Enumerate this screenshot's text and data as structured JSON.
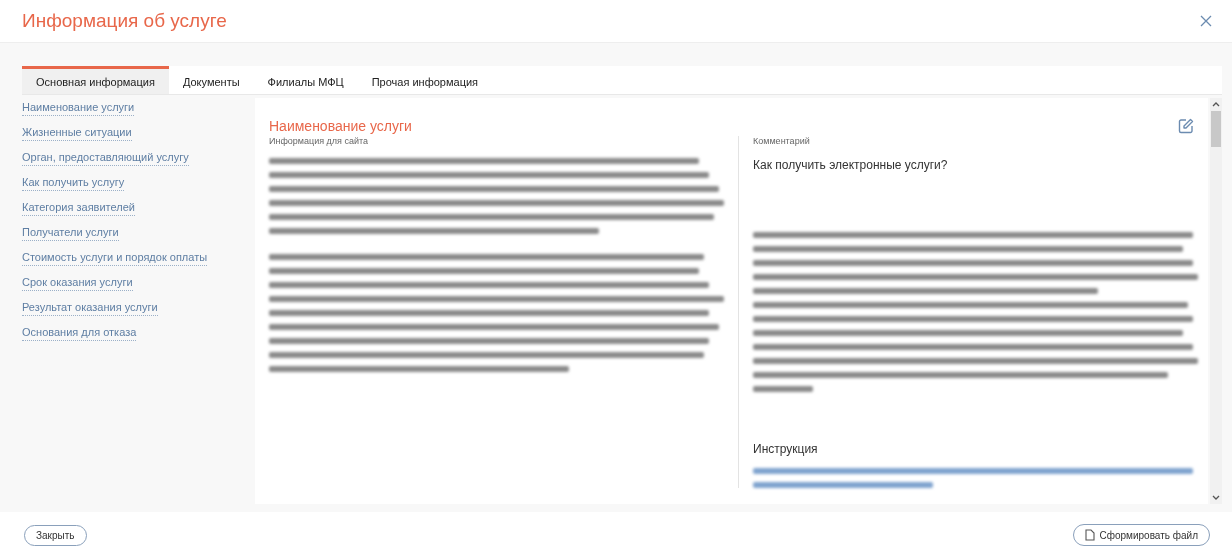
{
  "window": {
    "title": "Информация об услуге"
  },
  "tabs": [
    {
      "label": "Основная информация",
      "selected": true
    },
    {
      "label": "Документы",
      "selected": false
    },
    {
      "label": "Филиалы МФЦ",
      "selected": false
    },
    {
      "label": "Прочая информация",
      "selected": false
    }
  ],
  "sidebar": {
    "items": [
      "Наименование услуги",
      "Жизненные ситуации",
      "Орган, предоставляющий услугу",
      "Как получить услугу",
      "Категория заявителей",
      "Получатели услуги",
      "Стоимость услуги и порядок оплаты",
      "Срок оказания услуги",
      "Результат оказания услуги",
      "Основания для отказа"
    ]
  },
  "section": {
    "title": "Наименование услуги",
    "left": {
      "label": "Информация для сайта"
    },
    "right": {
      "label": "Комментарий",
      "heading": "Как получить электронные услуги?",
      "subheading": "Инструкция"
    }
  },
  "buttons": {
    "close": "Закрыть",
    "generate": "Сформировать файл"
  }
}
